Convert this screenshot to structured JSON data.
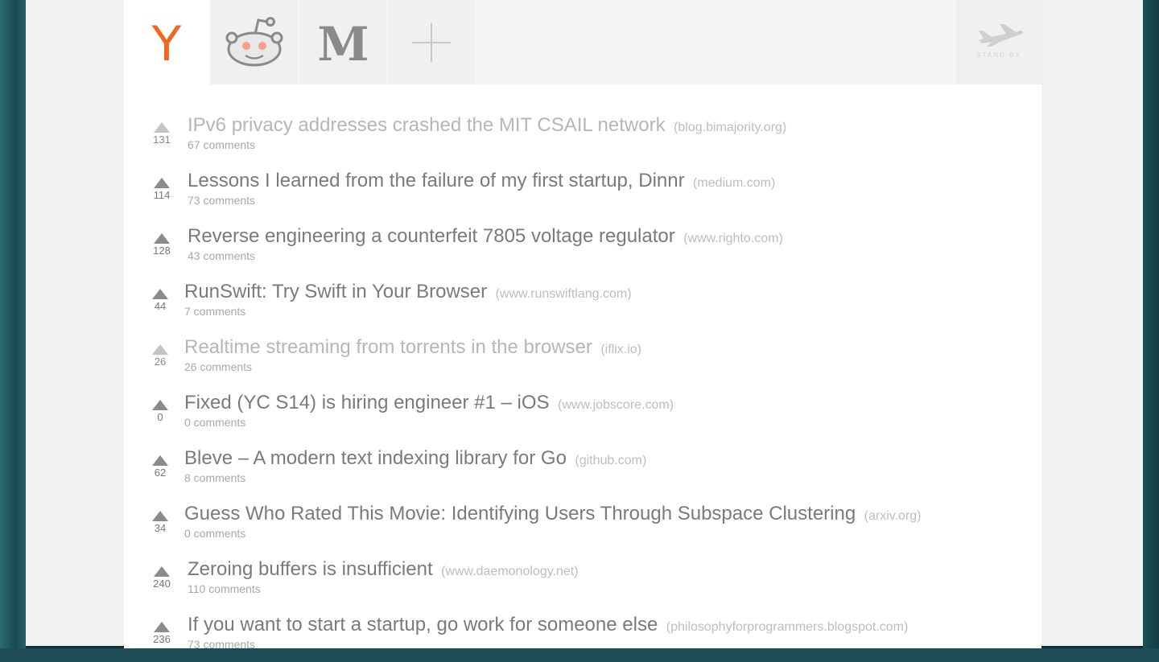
{
  "tabs": [
    {
      "name": "hacker-news",
      "glyph": "Y",
      "active": true
    },
    {
      "name": "reddit",
      "active": false
    },
    {
      "name": "medium",
      "glyph": "M",
      "active": false
    },
    {
      "name": "add",
      "active": false
    }
  ],
  "standby": {
    "label": "STAND BY"
  },
  "colors": {
    "hn_orange": "#f26522",
    "title": "#7a7a7a",
    "read_title": "#b6b6b6",
    "domain": "#bdbdbd"
  },
  "stories": [
    {
      "points": "131",
      "title": "IPv6 privacy addresses crashed the MIT CSAIL network",
      "domain": "(blog.bimajority.org)",
      "comments": "67 comments",
      "read": true
    },
    {
      "points": "114",
      "title": "Lessons I learned from the failure of my first startup, Dinnr",
      "domain": "(medium.com)",
      "comments": "73 comments",
      "read": false
    },
    {
      "points": "128",
      "title": "Reverse engineering a counterfeit 7805 voltage regulator",
      "domain": "(www.righto.com)",
      "comments": "43 comments",
      "read": false
    },
    {
      "points": "44",
      "title": "RunSwift: Try Swift in Your Browser",
      "domain": "(www.runswiftlang.com)",
      "comments": "7 comments",
      "read": false
    },
    {
      "points": "26",
      "title": "Realtime streaming from torrents in the browser",
      "domain": "(iflix.io)",
      "comments": "26 comments",
      "read": true
    },
    {
      "points": "0",
      "title": "Fixed (YC S14) is hiring engineer #1 – iOS",
      "domain": "(www.jobscore.com)",
      "comments": "0 comments",
      "read": false
    },
    {
      "points": "62",
      "title": "Bleve – A modern text indexing library for Go",
      "domain": "(github.com)",
      "comments": "8 comments",
      "read": false
    },
    {
      "points": "34",
      "title": "Guess Who Rated This Movie: Identifying Users Through Subspace Clustering",
      "domain": "(arxiv.org)",
      "comments": "0 comments",
      "read": false
    },
    {
      "points": "240",
      "title": "Zeroing buffers is insufficient",
      "domain": "(www.daemonology.net)",
      "comments": "110 comments",
      "read": false
    },
    {
      "points": "236",
      "title": "If you want to start a startup, go work for someone else",
      "domain": "(philosophyforprogrammers.blogspot.com)",
      "comments": "73 comments",
      "read": false
    }
  ]
}
